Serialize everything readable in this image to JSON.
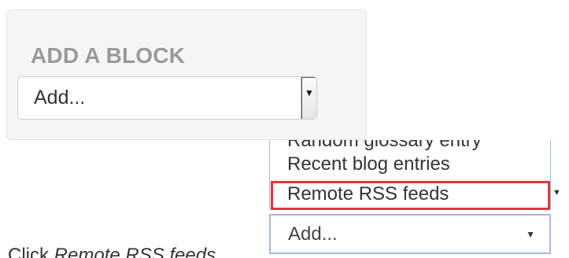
{
  "block_panel": {
    "title": "ADD A BLOCK",
    "select_value": "Add..."
  },
  "dropdown": {
    "items": [
      "Random glossary entry",
      "Recent blog entries",
      "Remote RSS feeds"
    ],
    "highlighted_item": "Remote RSS feeds",
    "select_value": "Add..."
  },
  "caption": {
    "prefix": "Click ",
    "target": "Remote RSS feeds"
  },
  "colors": {
    "highlight_border": "#e0393e",
    "panel_background": "#f5f5f5",
    "title_text": "#999999"
  },
  "icons": {
    "select_arrow": "triangle-down-icon",
    "list_arrow": "triangle-down-icon"
  }
}
